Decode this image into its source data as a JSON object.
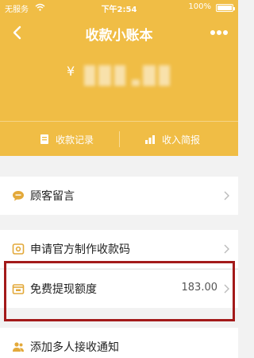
{
  "status_bar": {
    "carrier": "无服务",
    "time": "下午2:54",
    "battery": "100%"
  },
  "nav": {
    "title": "收款小账本"
  },
  "balance": {
    "currency_symbol": "¥"
  },
  "tabs": [
    {
      "label": "收款记录",
      "icon": "receipt-icon"
    },
    {
      "label": "收入简报",
      "icon": "bar-chart-icon"
    }
  ],
  "list": {
    "customer_message": {
      "label": "顾客留言",
      "icon": "chat-bubble-icon"
    },
    "apply_code": {
      "label": "申请官方制作收款码",
      "icon": "qr-card-icon"
    },
    "free_quota": {
      "label": "免费提现额度",
      "value": "183.00",
      "icon": "wallet-icon"
    },
    "add_receiver": {
      "label": "添加多人接收通知",
      "icon": "people-icon"
    }
  },
  "colors": {
    "header": "#f0bd45",
    "highlight": "#a31a1a",
    "icon_accent": "#e3a93a"
  }
}
